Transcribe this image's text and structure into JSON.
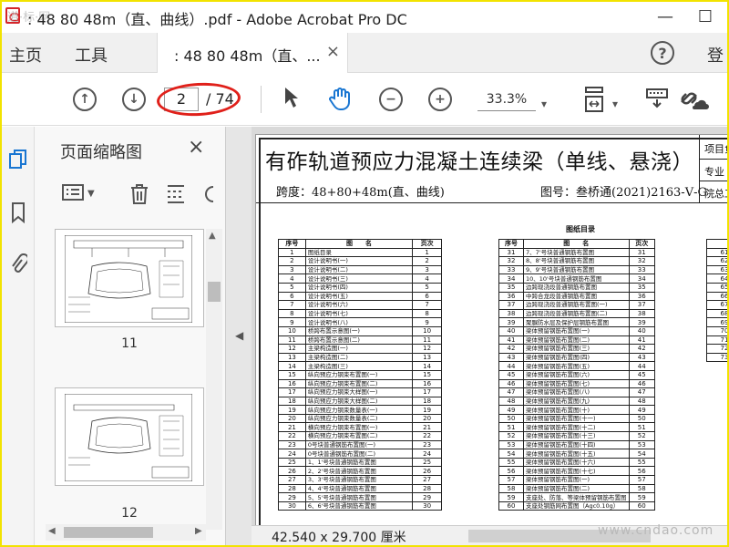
{
  "window": {
    "title": ": 48 80 48m（直、曲线）.pdf - Adobe Acrobat Pro DC",
    "minimize": "—",
    "maximize": "☐",
    "watermark_logo": "道·标·网"
  },
  "menubar": {
    "home": "主页",
    "tools": "工具",
    "tab_label": ": 48 80 48m（直、...",
    "tab_close": "×",
    "help": "?",
    "login": "登"
  },
  "toolbar": {
    "page_current": "2",
    "page_total": "/ 74",
    "zoom": "33.3%"
  },
  "panel": {
    "title": "页面缩略图",
    "close": "×",
    "thumbnails": [
      {
        "label": "11"
      },
      {
        "label": "12"
      }
    ]
  },
  "document": {
    "title": "有砟轨道预应力混凝土连续梁（单线、悬浇）",
    "span": "跨度：48+80+48m(直、曲线)",
    "drawing_no": "图号：叁桥通(2021)2163-Ⅴ-G",
    "header_cells": [
      "项目负",
      "专业",
      "院总工"
    ],
    "index_title": "图纸目录",
    "col_headers": [
      "序号",
      "图　　名",
      "页次"
    ],
    "table1": [
      [
        "1",
        "图纸目录",
        "1"
      ],
      [
        "2",
        "设计说明书(一)",
        "2"
      ],
      [
        "3",
        "设计说明书(二)",
        "3"
      ],
      [
        "4",
        "设计说明书(三)",
        "4"
      ],
      [
        "5",
        "设计说明书(四)",
        "5"
      ],
      [
        "6",
        "设计说明书(五)",
        "6"
      ],
      [
        "7",
        "设计说明书(六)",
        "7"
      ],
      [
        "8",
        "设计说明书(七)",
        "8"
      ],
      [
        "9",
        "设计说明书(八)",
        "9"
      ],
      [
        "10",
        "桥跨布置示意图(一)",
        "10"
      ],
      [
        "11",
        "桥跨布置示意图(二)",
        "11"
      ],
      [
        "12",
        "主梁构造图(一)",
        "12"
      ],
      [
        "13",
        "主梁构造图(二)",
        "13"
      ],
      [
        "14",
        "主梁构造图(三)",
        "14"
      ],
      [
        "15",
        "纵向预应力钢束布置图(一)",
        "15"
      ],
      [
        "16",
        "纵向预应力钢束布置图(二)",
        "16"
      ],
      [
        "17",
        "纵向预应力钢束大样图(一)",
        "17"
      ],
      [
        "18",
        "纵向预应力钢束大样图(二)",
        "18"
      ],
      [
        "19",
        "纵向预应力钢束数量表(一)",
        "19"
      ],
      [
        "20",
        "纵向预应力钢束数量表(二)",
        "20"
      ],
      [
        "21",
        "横向预应力钢束布置图(一)",
        "21"
      ],
      [
        "22",
        "横向预应力钢束布置图(二)",
        "22"
      ],
      [
        "23",
        "0号块普通钢筋布置图(一)",
        "23"
      ],
      [
        "24",
        "0号块普通钢筋布置图(二)",
        "24"
      ],
      [
        "25",
        "1、1'号块普通钢筋布置图",
        "25"
      ],
      [
        "26",
        "2、2'号块普通钢筋布置图",
        "26"
      ],
      [
        "27",
        "3、3'号块普通钢筋布置图",
        "27"
      ],
      [
        "28",
        "4、4'号块普通钢筋布置图",
        "28"
      ],
      [
        "29",
        "5、5'号块普通钢筋布置图",
        "29"
      ],
      [
        "30",
        "6、6'号块普通钢筋布置图",
        "30"
      ]
    ],
    "table2": [
      [
        "31",
        "7、7'号块普通钢筋布置图",
        "31"
      ],
      [
        "32",
        "8、8'号块普通钢筋布置图",
        "32"
      ],
      [
        "33",
        "9、9'号块普通钢筋布置图",
        "33"
      ],
      [
        "34",
        "10、10'号块普通钢筋布置图",
        "34"
      ],
      [
        "35",
        "边跨现浇段普通钢筋布置图",
        "35"
      ],
      [
        "36",
        "中跨合龙段普通钢筋布置图",
        "36"
      ],
      [
        "37",
        "边跨现浇段普通钢筋布置图(一)",
        "37"
      ],
      [
        "38",
        "边跨现浇段普通钢筋布置图(二)",
        "38"
      ],
      [
        "39",
        "聚脲防水层及保护层钢筋布置图",
        "39"
      ],
      [
        "40",
        "梁体预留钢筋布置图(一)",
        "40"
      ],
      [
        "41",
        "梁体预留钢筋布置图(二)",
        "41"
      ],
      [
        "42",
        "梁体预留钢筋布置图(三)",
        "42"
      ],
      [
        "43",
        "梁体预留钢筋布置图(四)",
        "43"
      ],
      [
        "44",
        "梁体预留钢筋布置图(五)",
        "44"
      ],
      [
        "45",
        "梁体预留钢筋布置图(六)",
        "45"
      ],
      [
        "46",
        "梁体预留钢筋布置图(七)",
        "46"
      ],
      [
        "47",
        "梁体预留钢筋布置图(八)",
        "47"
      ],
      [
        "48",
        "梁体预留钢筋布置图(九)",
        "48"
      ],
      [
        "49",
        "梁体预留钢筋布置图(十)",
        "49"
      ],
      [
        "50",
        "梁体预留钢筋布置图(十一)",
        "50"
      ],
      [
        "51",
        "梁体预留钢筋布置图(十二)",
        "51"
      ],
      [
        "52",
        "梁体预留钢筋布置图(十三)",
        "52"
      ],
      [
        "53",
        "梁体预留钢筋布置图(十四)",
        "53"
      ],
      [
        "54",
        "梁体预留钢筋布置图(十五)",
        "54"
      ],
      [
        "55",
        "梁体预留钢筋布置图(十六)",
        "55"
      ],
      [
        "56",
        "梁体预留钢筋布置图(十七)",
        "56"
      ],
      [
        "57",
        "梁体预留钢筋布置图(一)",
        "57"
      ],
      [
        "58",
        "梁体预留钢筋布置图(二)",
        "58"
      ],
      [
        "59",
        "支座处、防落、等梁体预留钢筋布置图",
        "59"
      ],
      [
        "60",
        "支座处钢筋网布置图（Agc0.10g）",
        "60"
      ]
    ],
    "table3": [
      "61",
      "62",
      "63",
      "64",
      "65",
      "66",
      "67",
      "68",
      "69",
      "70",
      "71",
      "72",
      "73"
    ]
  },
  "status": {
    "dimensions": "42.540 x 29.700 厘米",
    "watermark": "www.cndao.com"
  }
}
